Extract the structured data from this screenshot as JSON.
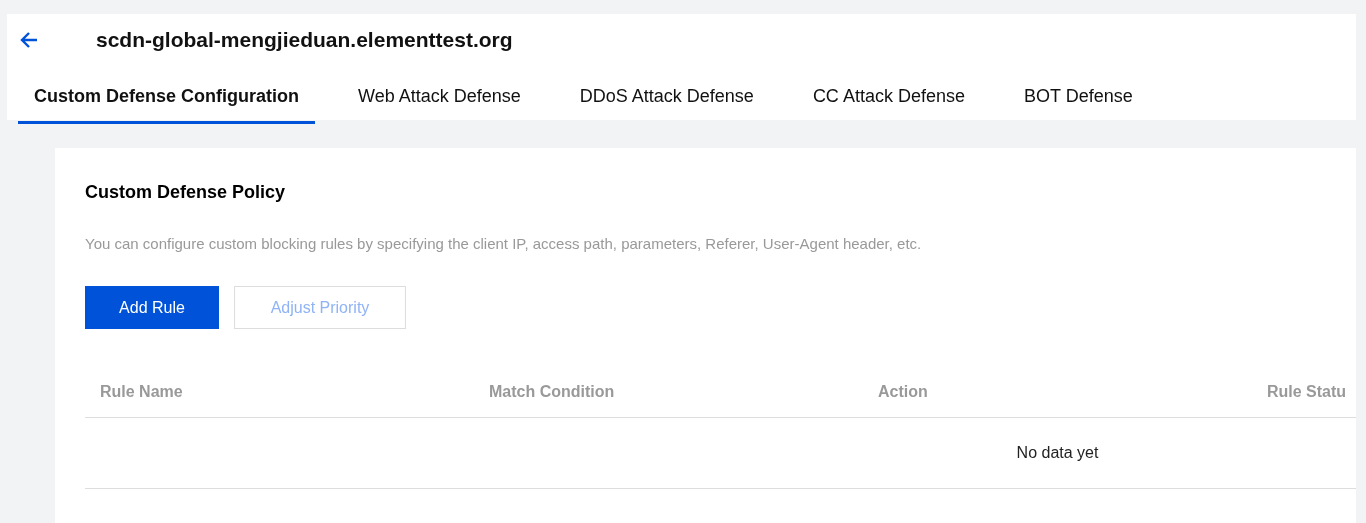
{
  "header": {
    "title": "scdn-global-mengjieduan.elementtest.org"
  },
  "tabs": [
    {
      "label": "Custom Defense Configuration",
      "selected": true
    },
    {
      "label": "Web Attack Defense",
      "selected": false
    },
    {
      "label": "DDoS Attack Defense",
      "selected": false
    },
    {
      "label": "CC Attack Defense",
      "selected": false
    },
    {
      "label": "BOT Defense",
      "selected": false
    }
  ],
  "policy": {
    "title": "Custom Defense Policy",
    "description": "You can configure custom blocking rules by specifying the client IP, access path, parameters, Referer, User-Agent header, etc.",
    "buttons": [
      {
        "label": "Add Rule",
        "kind": "primary",
        "disabled": false
      },
      {
        "label": "Adjust Priority",
        "kind": "secondary",
        "disabled": true
      }
    ]
  },
  "table": {
    "columns": [
      "Rule Name",
      "Match Condition",
      "Action",
      "Rule Statu"
    ],
    "empty_text": "No data yet"
  }
}
